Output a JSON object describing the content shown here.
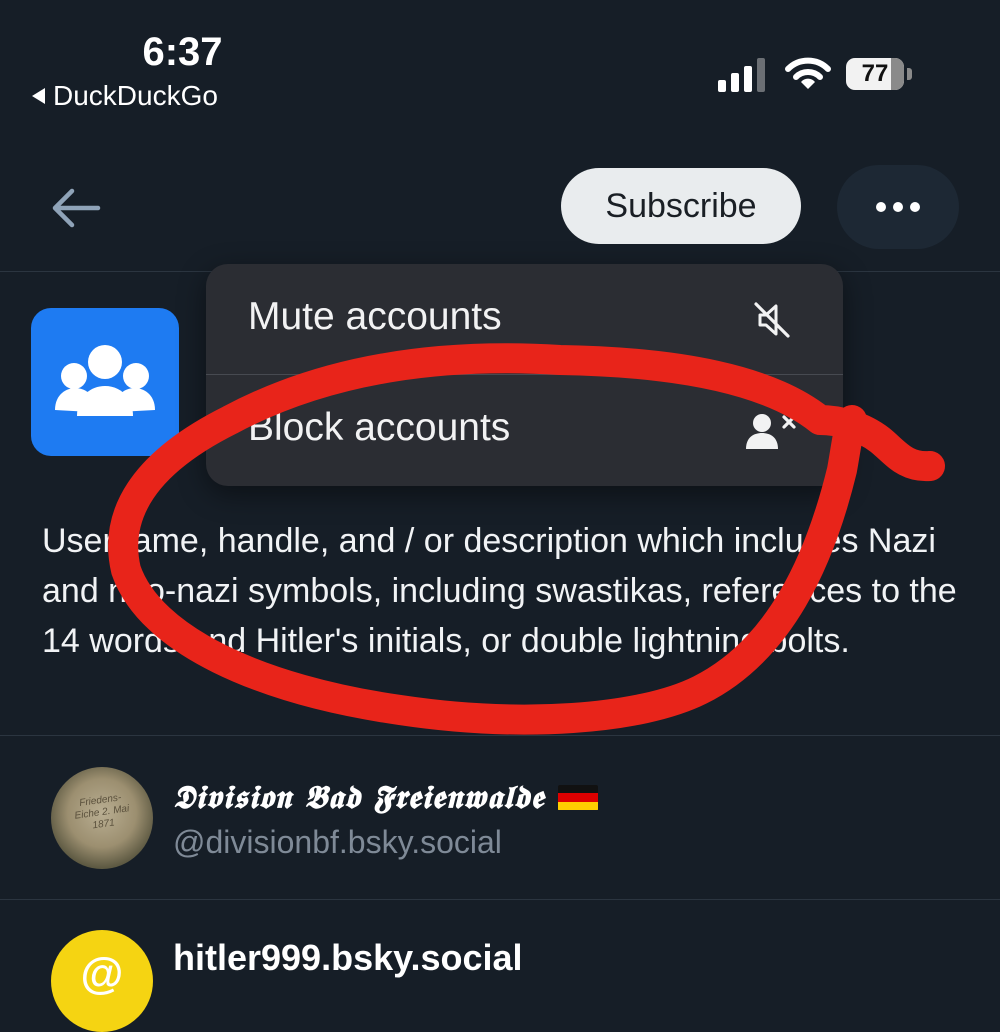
{
  "status_bar": {
    "time": "6:37",
    "back_app": "DuckDuckGo",
    "battery_level": "77",
    "icons": [
      "signal-icon",
      "wifi-icon",
      "battery-icon"
    ]
  },
  "header": {
    "back_icon": "arrow-left-icon",
    "subscribe_label": "Subscribe",
    "more_icon": "ellipsis-icon"
  },
  "menu": {
    "items": [
      {
        "label": "Mute accounts",
        "icon": "speaker-muted-icon"
      },
      {
        "label": "Block accounts",
        "icon": "person-x-icon"
      }
    ]
  },
  "list": {
    "avatar_icon": "people-group-icon",
    "avatar_color": "#1e7bf2",
    "description": "Username, handle, and / or description which includes Nazi and neo-nazi symbols, including swastikas, references to the 14 words and Hitler's initials, or double lightning bolts."
  },
  "accounts": [
    {
      "name": "𝕯𝖎𝖛𝖎𝖘𝖎𝖔𝖓 𝕭𝖆𝖉 𝕱𝖗𝖊𝖎𝖊𝖓𝖜𝖆𝖑𝖉𝖊",
      "flag": "german-flag-icon",
      "handle": "@divisionbf.bsky.social",
      "avatar_text": "Friedens-\nEiche 2. Mai\n1871"
    },
    {
      "name": "hitler999.bsky.social",
      "avatar_glyph": "@",
      "avatar_color": "#f5d412"
    }
  ],
  "annotation": {
    "color": "#e8241a"
  }
}
